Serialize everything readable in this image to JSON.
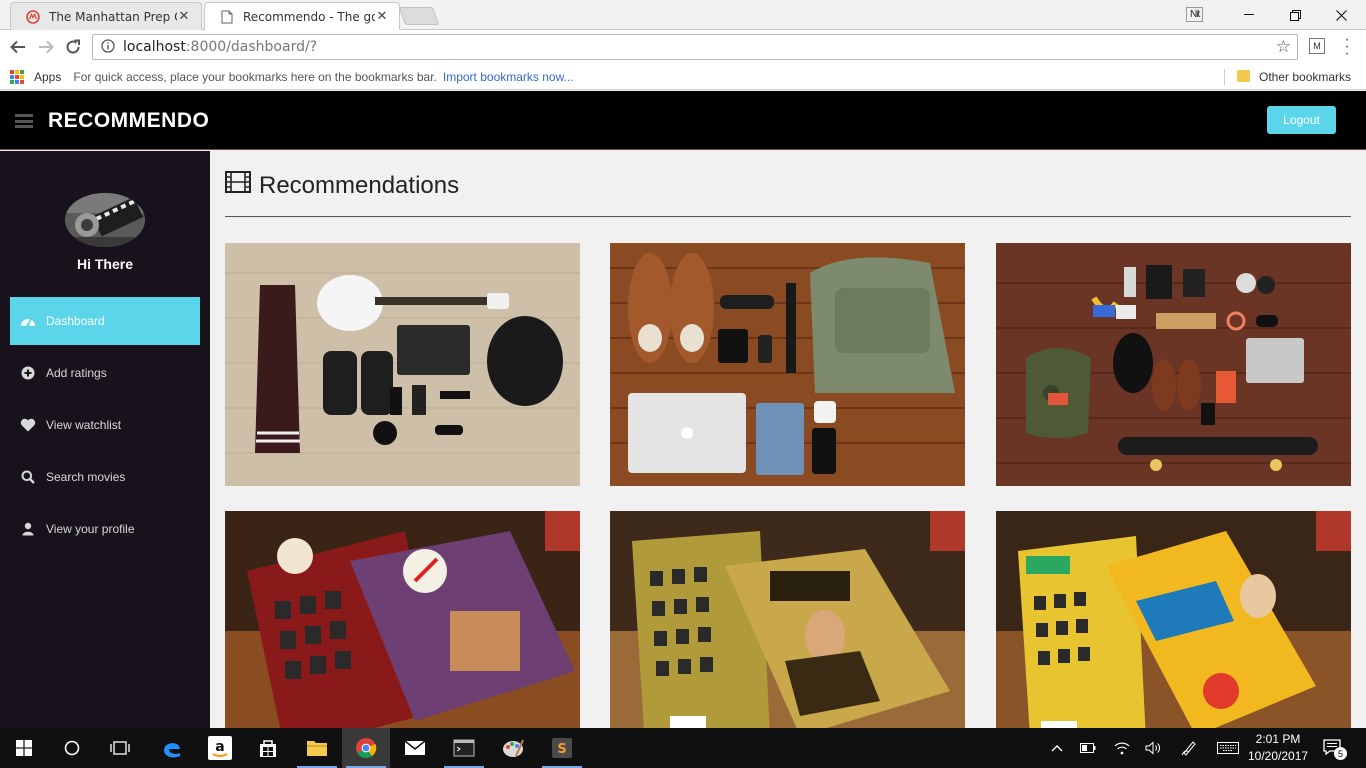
{
  "browser": {
    "tabs": [
      {
        "title": "The Manhattan Prep GRE",
        "active": false
      },
      {
        "title": "Recommendo - The go-t",
        "active": true
      }
    ],
    "url_host": "localhost",
    "url_path": ":8000/dashboard/?",
    "profile_chip": "Nit",
    "bookmarks": {
      "apps_label": "Apps",
      "hint": "For quick access, place your bookmarks here on the bookmarks bar.",
      "import_link": "Import bookmarks now...",
      "other": "Other bookmarks"
    }
  },
  "app": {
    "brand": "RECOMMENDO",
    "logout_label": "Logout",
    "accent_color": "#5bd5ea",
    "greeting": "Hi There",
    "nav": [
      {
        "label": "Dashboard",
        "icon": "dashboard-icon",
        "active": true
      },
      {
        "label": "Add ratings",
        "icon": "plus-circle-icon",
        "active": false
      },
      {
        "label": "View watchlist",
        "icon": "heart-icon",
        "active": false
      },
      {
        "label": "Search movies",
        "icon": "search-icon",
        "active": false
      },
      {
        "label": "View your profile",
        "icon": "user-icon",
        "active": false
      }
    ],
    "heading": "Recommendations",
    "cards": [
      {
        "subject": "flat-lay-guitar-jacket"
      },
      {
        "subject": "flat-lay-shoes-bag-laptop"
      },
      {
        "subject": "flat-lay-backpack-skateboard"
      },
      {
        "subject": "book-fad-free"
      },
      {
        "subject": "book-out-front"
      },
      {
        "subject": "book-marketing-miracles"
      }
    ]
  },
  "taskbar": {
    "time": "2:01 PM",
    "date": "10/20/2017",
    "notification_count": "5"
  }
}
